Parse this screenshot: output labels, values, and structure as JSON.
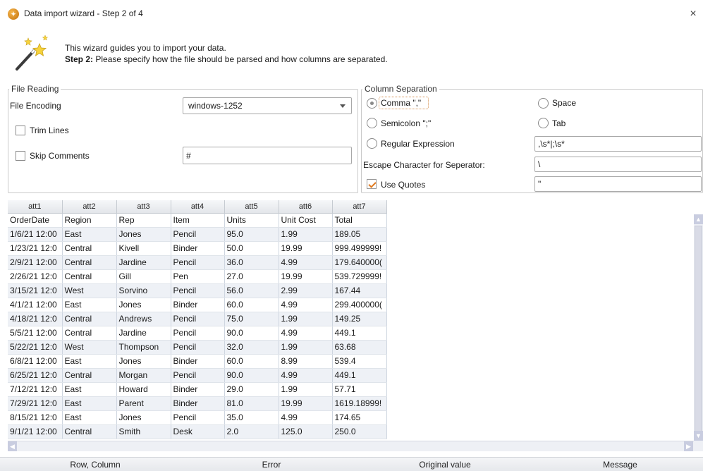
{
  "window": {
    "title": "Data import wizard - Step 2 of 4",
    "close_glyph": "×"
  },
  "header": {
    "intro": "This wizard guides you to import your data.",
    "step_label": "Step 2:",
    "step_text": " Please specify how the file should be parsed and how columns are separated."
  },
  "file_reading": {
    "title": "File Reading",
    "encoding_label": "File Encoding",
    "encoding_value": "windows-1252",
    "trim_lines_label": "Trim Lines",
    "trim_lines_checked": false,
    "skip_comments_label": "Skip Comments",
    "skip_comments_checked": false,
    "comment_char": "#"
  },
  "column_separation": {
    "title": "Column Separation",
    "comma_label": "Comma \",\"",
    "space_label": "Space",
    "semicolon_label": "Semicolon \";\"",
    "tab_label": "Tab",
    "regex_label": "Regular Expression",
    "regex_value": ",\\s*|;\\s*",
    "selected": "comma",
    "escape_label": "Escape Character for Seperator:",
    "escape_value": "\\",
    "use_quotes_label": "Use Quotes",
    "use_quotes_checked": true,
    "quote_value": "\""
  },
  "table": {
    "columns": [
      "att1",
      "att2",
      "att3",
      "att4",
      "att5",
      "att6",
      "att7"
    ],
    "rows": [
      [
        "OrderDate",
        "Region",
        "Rep",
        "Item",
        "Units",
        "Unit Cost",
        "Total"
      ],
      [
        "1/6/21 12:00",
        "East",
        "Jones",
        "Pencil",
        "95.0",
        "1.99",
        "189.05"
      ],
      [
        "1/23/21 12:0",
        "Central",
        "Kivell",
        "Binder",
        "50.0",
        "19.99",
        "999.499999!"
      ],
      [
        "2/9/21 12:00",
        "Central",
        "Jardine",
        "Pencil",
        "36.0",
        "4.99",
        "179.640000("
      ],
      [
        "2/26/21 12:0",
        "Central",
        "Gill",
        "Pen",
        "27.0",
        "19.99",
        "539.729999!"
      ],
      [
        "3/15/21 12:0",
        "West",
        "Sorvino",
        "Pencil",
        "56.0",
        "2.99",
        "167.44"
      ],
      [
        "4/1/21 12:00",
        "East",
        "Jones",
        "Binder",
        "60.0",
        "4.99",
        "299.400000("
      ],
      [
        "4/18/21 12:0",
        "Central",
        "Andrews",
        "Pencil",
        "75.0",
        "1.99",
        "149.25"
      ],
      [
        "5/5/21 12:00",
        "Central",
        "Jardine",
        "Pencil",
        "90.0",
        "4.99",
        "449.1"
      ],
      [
        "5/22/21 12:0",
        "West",
        "Thompson",
        "Pencil",
        "32.0",
        "1.99",
        "63.68"
      ],
      [
        "6/8/21 12:00",
        "East",
        "Jones",
        "Binder",
        "60.0",
        "8.99",
        "539.4"
      ],
      [
        "6/25/21 12:0",
        "Central",
        "Morgan",
        "Pencil",
        "90.0",
        "4.99",
        "449.1"
      ],
      [
        "7/12/21 12:0",
        "East",
        "Howard",
        "Binder",
        "29.0",
        "1.99",
        "57.71"
      ],
      [
        "7/29/21 12:0",
        "East",
        "Parent",
        "Binder",
        "81.0",
        "19.99",
        "1619.18999!"
      ],
      [
        "8/15/21 12:0",
        "East",
        "Jones",
        "Pencil",
        "35.0",
        "4.99",
        "174.65"
      ],
      [
        "9/1/21 12:00",
        "Central",
        "Smith",
        "Desk",
        "2.0",
        "125.0",
        "250.0"
      ]
    ]
  },
  "error_table": {
    "columns": [
      "Row, Column",
      "Error",
      "Original value",
      "Message"
    ]
  },
  "colors": {
    "accent_check": "#e07a1f",
    "row_alt": "#eef1f6",
    "scrollbar": "#c9cde0"
  }
}
